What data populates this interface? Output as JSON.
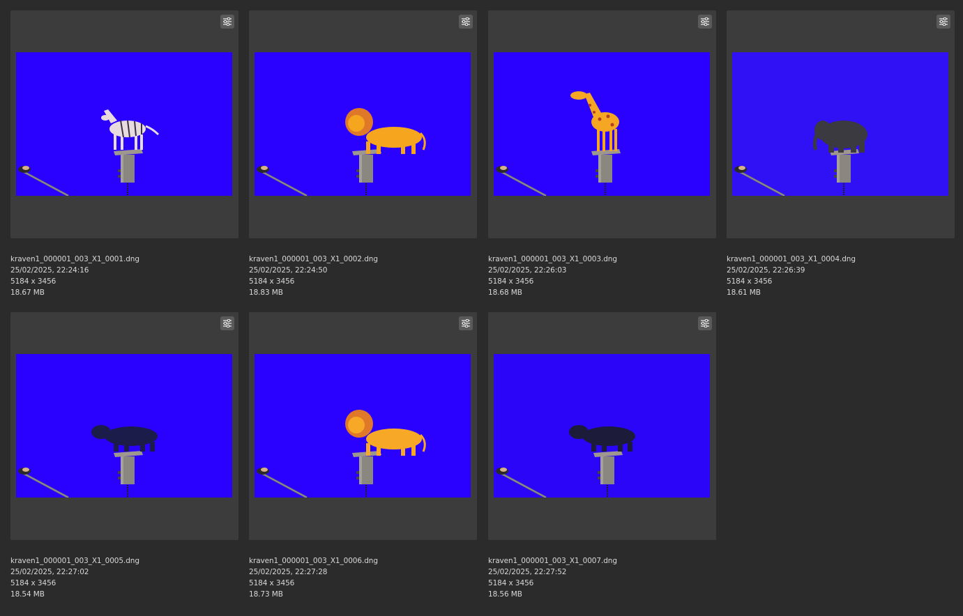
{
  "gallery": {
    "items": [
      {
        "filename": "kraven1_000001_003_X1_0001.dng",
        "datetime": "25/02/2025, 22:24:16",
        "dimensions": "5184 x 3456",
        "size": "18.67 MB",
        "subject": "zebra",
        "subject_color": "#e8dbe0",
        "background_color": "#2a00ff"
      },
      {
        "filename": "kraven1_000001_003_X1_0002.dng",
        "datetime": "25/02/2025, 22:24:50",
        "dimensions": "5184 x 3456",
        "size": "18.83 MB",
        "subject": "lion",
        "subject_color": "#f5a51e",
        "background_color": "#2a00ff"
      },
      {
        "filename": "kraven1_000001_003_X1_0003.dng",
        "datetime": "25/02/2025, 22:26:03",
        "dimensions": "5184 x 3456",
        "size": "18.68 MB",
        "subject": "giraffe",
        "subject_color": "#f5a623",
        "background_color": "#2a00ff"
      },
      {
        "filename": "kraven1_000001_003_X1_0004.dng",
        "datetime": "25/02/2025, 22:26:39",
        "dimensions": "5184 x 3456",
        "size": "18.61 MB",
        "subject": "elephant",
        "subject_color": "#3a3a40",
        "background_color": "#3010f5"
      },
      {
        "filename": "kraven1_000001_003_X1_0005.dng",
        "datetime": "25/02/2025, 22:27:02",
        "dimensions": "5184 x 3456",
        "size": "18.54 MB",
        "subject": "hippo",
        "subject_color": "#1c1c4a",
        "background_color": "#2a00ff"
      },
      {
        "filename": "kraven1_000001_003_X1_0006.dng",
        "datetime": "25/02/2025, 22:27:28",
        "dimensions": "5184 x 3456",
        "size": "18.73 MB",
        "subject": "lion",
        "subject_color": "#f8a827",
        "background_color": "#2a00ff"
      },
      {
        "filename": "kraven1_000001_003_X1_0007.dng",
        "datetime": "25/02/2025, 22:27:52",
        "dimensions": "5184 x 3456",
        "size": "18.56 MB",
        "subject": "hippo",
        "subject_color": "#1c1c3a",
        "background_color": "#2a05f8"
      }
    ]
  },
  "colors": {
    "app_background": "#2b2b2b",
    "card_background": "#3c3c3c",
    "text": "#d8d8d8",
    "edit_button": "#5a5a5a"
  },
  "icons": {
    "edit": "sliders-adjust-icon"
  }
}
